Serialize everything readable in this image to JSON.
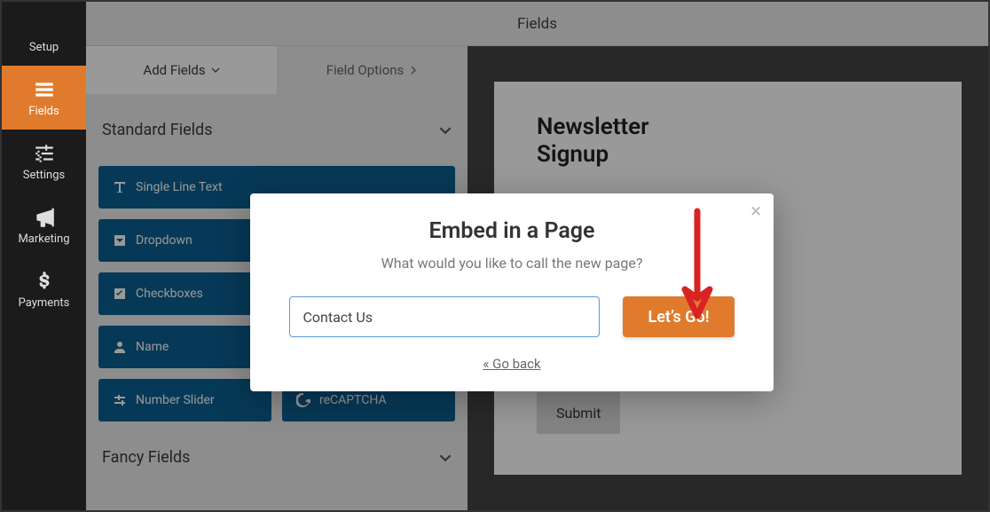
{
  "header": {
    "title": "Fields"
  },
  "sidebar": {
    "items": [
      {
        "label": "Setup"
      },
      {
        "label": "Fields"
      },
      {
        "label": "Settings"
      },
      {
        "label": "Marketing"
      },
      {
        "label": "Payments"
      }
    ]
  },
  "tabs": {
    "add": "Add Fields",
    "options": "Field Options"
  },
  "sections": {
    "standard": "Standard Fields",
    "fancy": "Fancy Fields"
  },
  "fields": {
    "single_line": "Single Line Text",
    "dropdown": "Dropdown",
    "checkboxes": "Checkboxes",
    "name": "Name",
    "number_slider": "Number Slider",
    "recaptcha": "reCAPTCHA"
  },
  "preview": {
    "heading": "Newsletter Signup",
    "submit": "Submit"
  },
  "modal": {
    "title": "Embed in a Page",
    "subtitle": "What would you like to call the new page?",
    "page_name": "Contact Us",
    "go": "Let’s Go!",
    "back": "« Go back"
  }
}
